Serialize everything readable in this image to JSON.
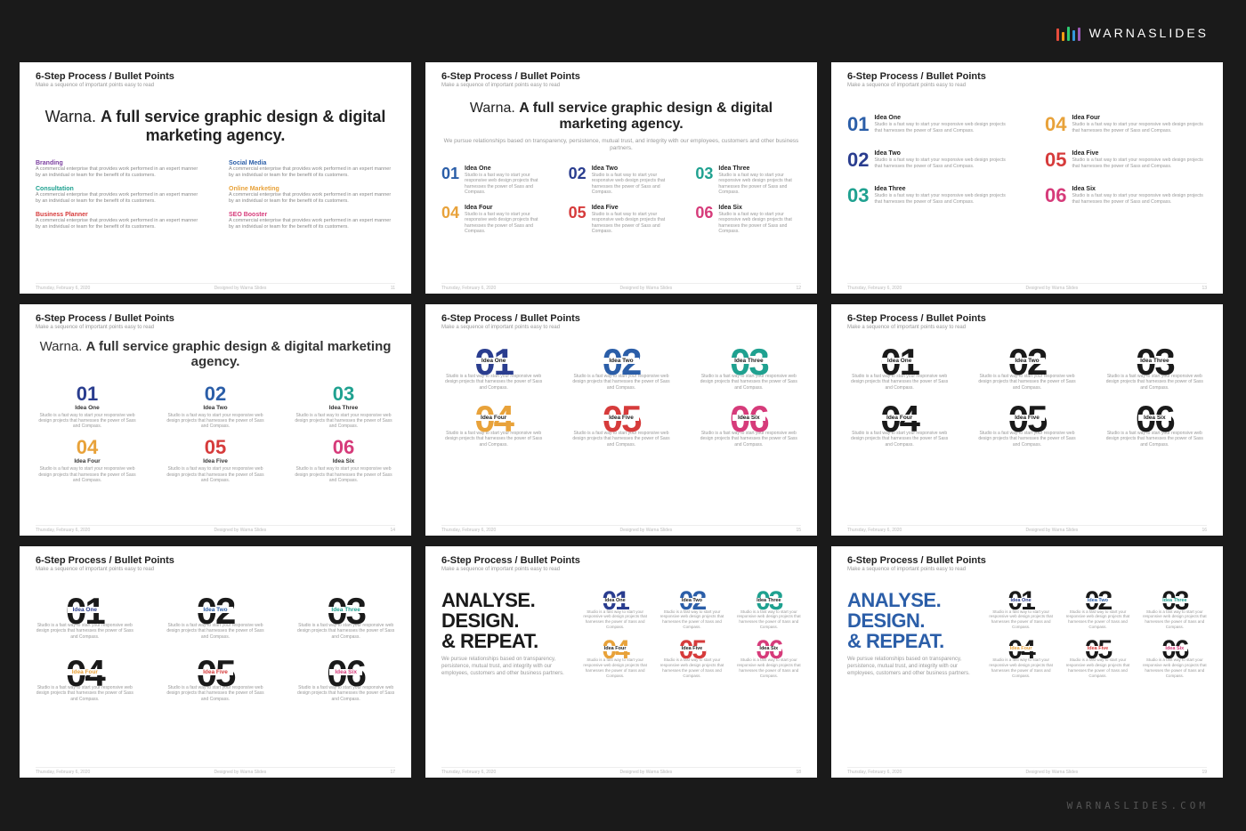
{
  "brand": "WARNASLIDES",
  "watermark": "WARNASLIDES.COM",
  "common": {
    "title": "6-Step Process / Bullet Points",
    "subtitle": "Make a sequence of important points easy to read",
    "footer_date": "Thursday, February 6, 2020",
    "footer_credit": "Designed by Warna Slides",
    "headline_html": "Warna. <b>A full service graphic design & digital marketing agency.</b>",
    "tagline": "We pursue relationships based on transparency, persistence, mutual trust, and integrity with our employees, customers and other business partners.",
    "idea_desc": "Studio is a fast way to start your responsive web design projects that harnesses the power of Sass and Compass.",
    "service_desc": "A commercial enterprise that provides work performed in an expert manner by an individual or team for the benefit of its customers.",
    "adr_lines": [
      "ANALYSE.",
      "DESIGN.",
      "& REPEAT."
    ]
  },
  "slide1": {
    "col1": [
      {
        "t": "Branding",
        "c": "c-purple"
      },
      {
        "t": "Consultation",
        "c": "c-teal"
      },
      {
        "t": "Business Planner",
        "c": "c-red"
      }
    ],
    "col2": [
      {
        "t": "Social Media",
        "c": "c-blue"
      },
      {
        "t": "Online Marketing",
        "c": "c-orange"
      },
      {
        "t": "SEO Booster",
        "c": "c-pink"
      }
    ]
  },
  "ideas6": [
    {
      "n": "01",
      "t": "Idea One",
      "c": "c-blue"
    },
    {
      "n": "02",
      "t": "Idea Two",
      "c": "c-navy"
    },
    {
      "n": "03",
      "t": "Idea Three",
      "c": "c-teal"
    },
    {
      "n": "04",
      "t": "Idea Four",
      "c": "c-orange"
    },
    {
      "n": "05",
      "t": "Idea Five",
      "c": "c-red"
    },
    {
      "n": "06",
      "t": "Idea Six",
      "c": "c-pink"
    }
  ],
  "ideas6_alt": [
    {
      "n": "01",
      "t": "Idea One",
      "c": "c-navy"
    },
    {
      "n": "02",
      "t": "Idea Two",
      "c": "c-blue"
    },
    {
      "n": "03",
      "t": "Idea Three",
      "c": "c-teal"
    },
    {
      "n": "04",
      "t": "Idea Four",
      "c": "c-orange"
    },
    {
      "n": "05",
      "t": "Idea Five",
      "c": "c-red"
    },
    {
      "n": "06",
      "t": "Idea Six",
      "c": "c-pink"
    }
  ],
  "page_numbers": [
    "11",
    "12",
    "13",
    "14",
    "15",
    "16",
    "17",
    "18",
    "19"
  ]
}
